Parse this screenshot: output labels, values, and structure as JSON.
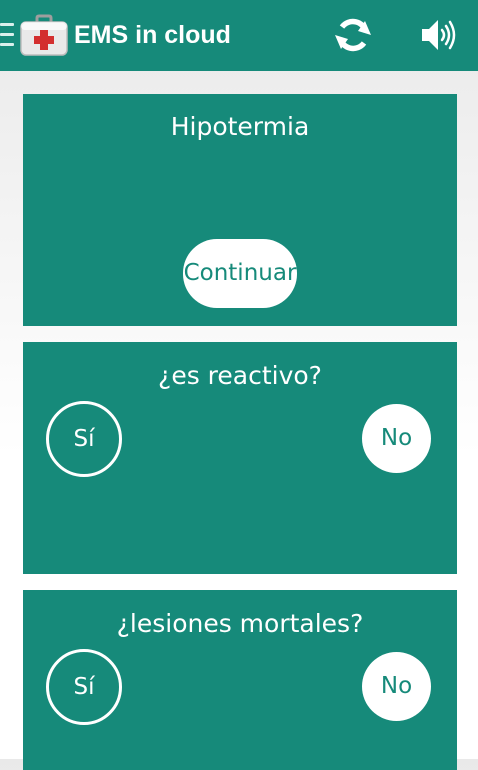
{
  "appbar": {
    "title": "EMS in cloud",
    "icons": [
      "menu-icon",
      "medical-kit-icon",
      "refresh-icon",
      "volume-icon"
    ]
  },
  "colors": {
    "primary": "#168a7a",
    "text_on_primary": "#ffffff",
    "button_bg": "#ffffff"
  },
  "cards": [
    {
      "title": "Hipotermia",
      "continue_label": "Continuar"
    },
    {
      "title": "¿es reactivo?",
      "yes_label": "Sí",
      "no_label": "No"
    },
    {
      "title": "¿lesiones mortales?",
      "yes_label": "Sí",
      "no_label": "No"
    }
  ]
}
